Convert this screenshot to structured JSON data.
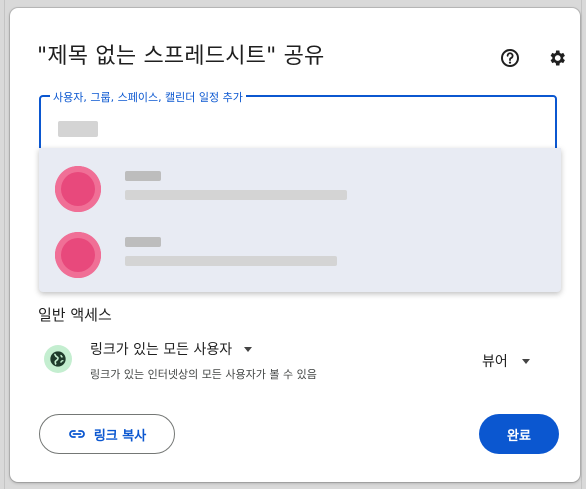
{
  "dialog": {
    "title": "\"제목 없는 스프레드시트\" 공유",
    "help_icon": "help-circle-icon",
    "settings_icon": "gear-icon"
  },
  "share_input": {
    "label": "사용자, 그룹, 스페이스, 캘린더 일정 추가",
    "value_redacted": true
  },
  "suggestions": [
    {
      "avatar_color": "#e8497c",
      "redacted": true
    },
    {
      "avatar_color": "#e8497c",
      "redacted": true
    }
  ],
  "general_access": {
    "title": "일반 액세스",
    "link_option": "링크가 있는 모든 사용자",
    "description": "링크가 있는 인터넷상의 모든 사용자가 볼 수 있음",
    "role": "뷰어",
    "icon": "globe-icon",
    "icon_bg": "#c4eed0"
  },
  "buttons": {
    "copy_link": "링크 복사",
    "done": "완료"
  },
  "colors": {
    "accent": "#0b57d0",
    "dropdown_bg": "#e8ebf3"
  }
}
